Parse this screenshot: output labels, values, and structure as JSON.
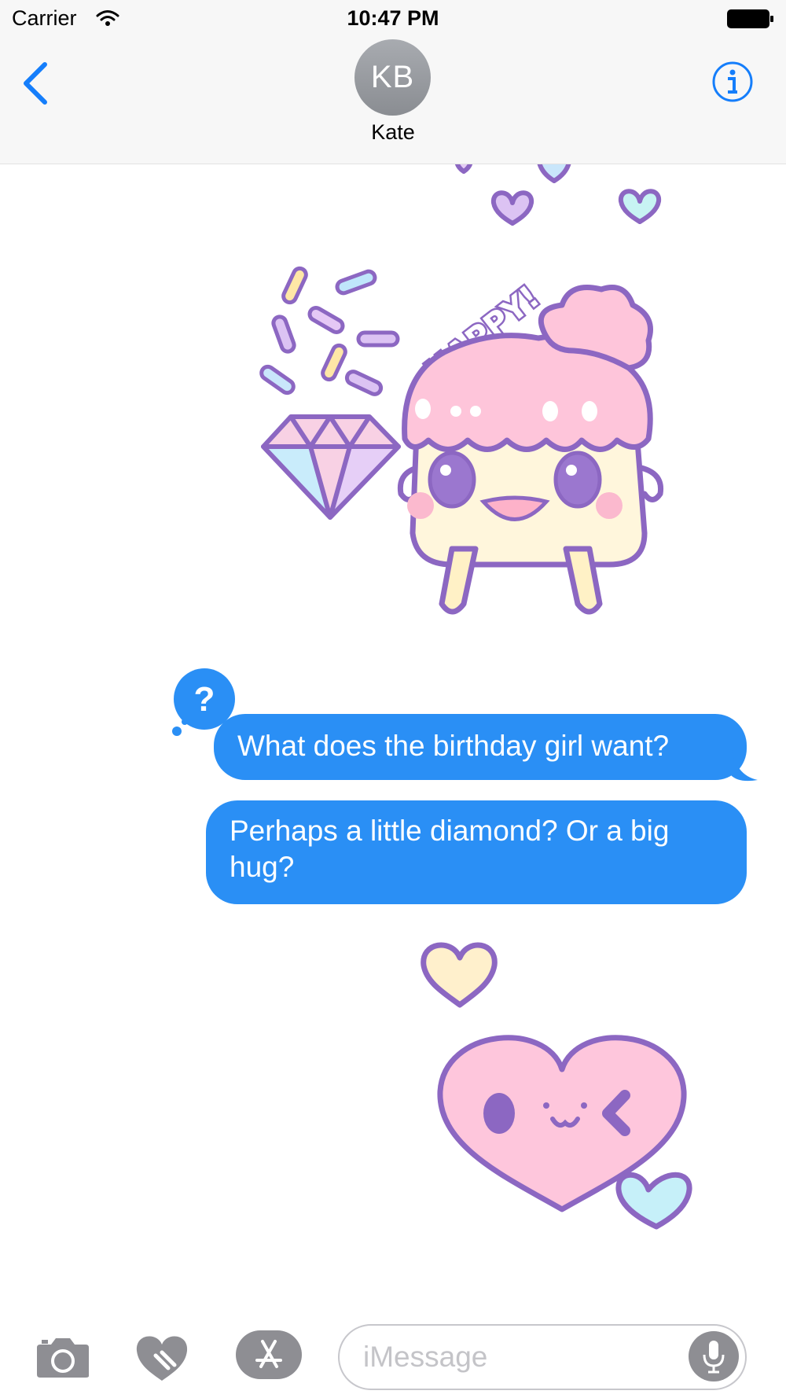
{
  "status_bar": {
    "carrier": "Carrier",
    "time": "10:47 PM",
    "icons": [
      "wifi-icon",
      "battery-icon"
    ]
  },
  "nav": {
    "back_icon": "chevron-left-icon",
    "avatar_initials": "KB",
    "contact_name": "Kate",
    "info_icon": "info-icon"
  },
  "conversation": {
    "stickers": [
      {
        "name": "hearts-sticker",
        "description_icon": "heart-icon"
      },
      {
        "name": "happy-cupcake-sticker",
        "text": "HAPPY!"
      },
      {
        "name": "wink-heart-sticker",
        "description_icon": "heart-icon"
      }
    ],
    "messages": [
      {
        "text": "What does the birthday girl want?",
        "sender": "me"
      },
      {
        "text": "Perhaps a little diamond? Or a big hug?",
        "sender": "me"
      }
    ],
    "badge_text": "?"
  },
  "toolbar": {
    "camera_icon": "camera-icon",
    "digital_touch_icon": "digital-touch-heart-icon",
    "app_store_icon": "app-store-icon",
    "input_placeholder": "iMessage",
    "input_value": "",
    "mic_icon": "microphone-icon"
  },
  "colors": {
    "bubble_blue": "#2a8ff5",
    "ios_blue": "#157efb",
    "sticker_outline": "#8c67c2",
    "pastel_pink": "#fdc6dc",
    "pastel_cream": "#fff5d8",
    "pastel_blue": "#c5f1f8"
  }
}
